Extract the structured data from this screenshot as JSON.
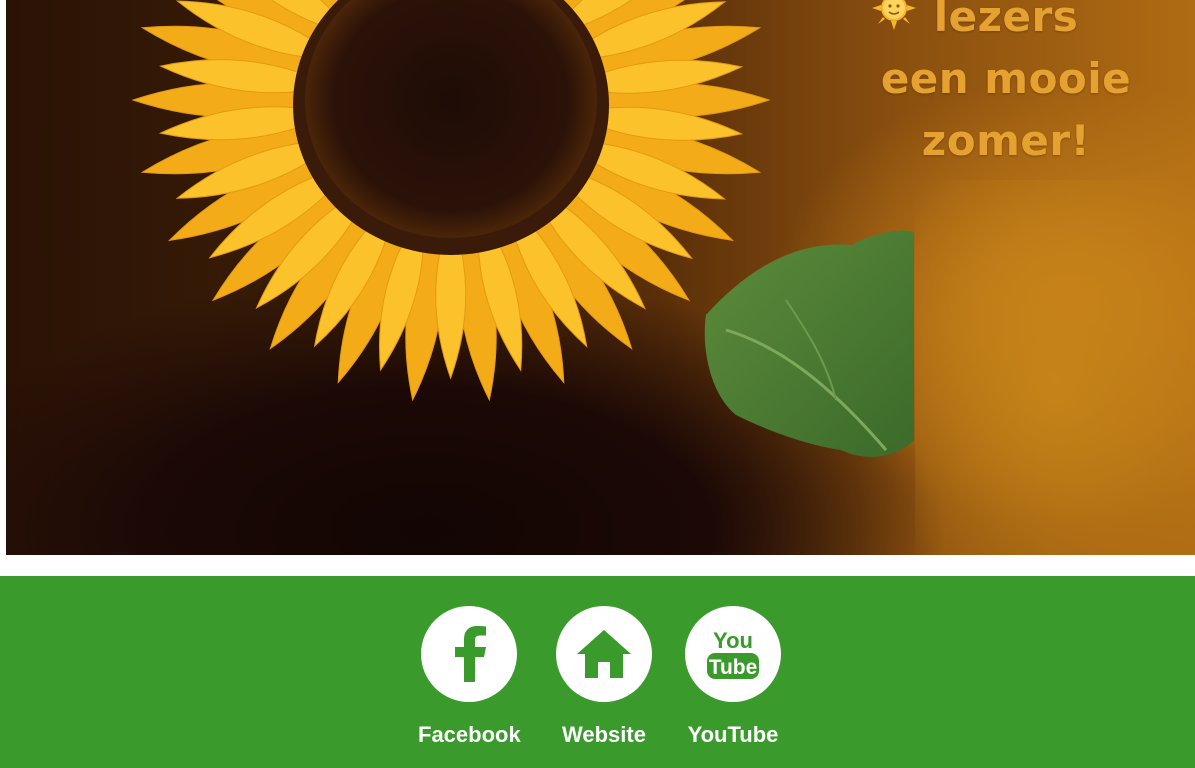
{
  "banner": {
    "greeting_lines": [
      "lezers",
      "een mooie",
      "zomer!"
    ],
    "emoji_icon": "sun-emoji-icon",
    "image": "sunflower"
  },
  "footer": {
    "background_color": "#3a9b2c",
    "links": [
      {
        "label": "Facebook",
        "icon": "facebook-icon"
      },
      {
        "label": "Website",
        "icon": "home-icon"
      },
      {
        "label": "YouTube",
        "icon": "youtube-icon"
      }
    ]
  },
  "colors": {
    "greeting_text": "#e6a230",
    "petal": "#f5b51f",
    "leaf": "#4d7a33"
  }
}
